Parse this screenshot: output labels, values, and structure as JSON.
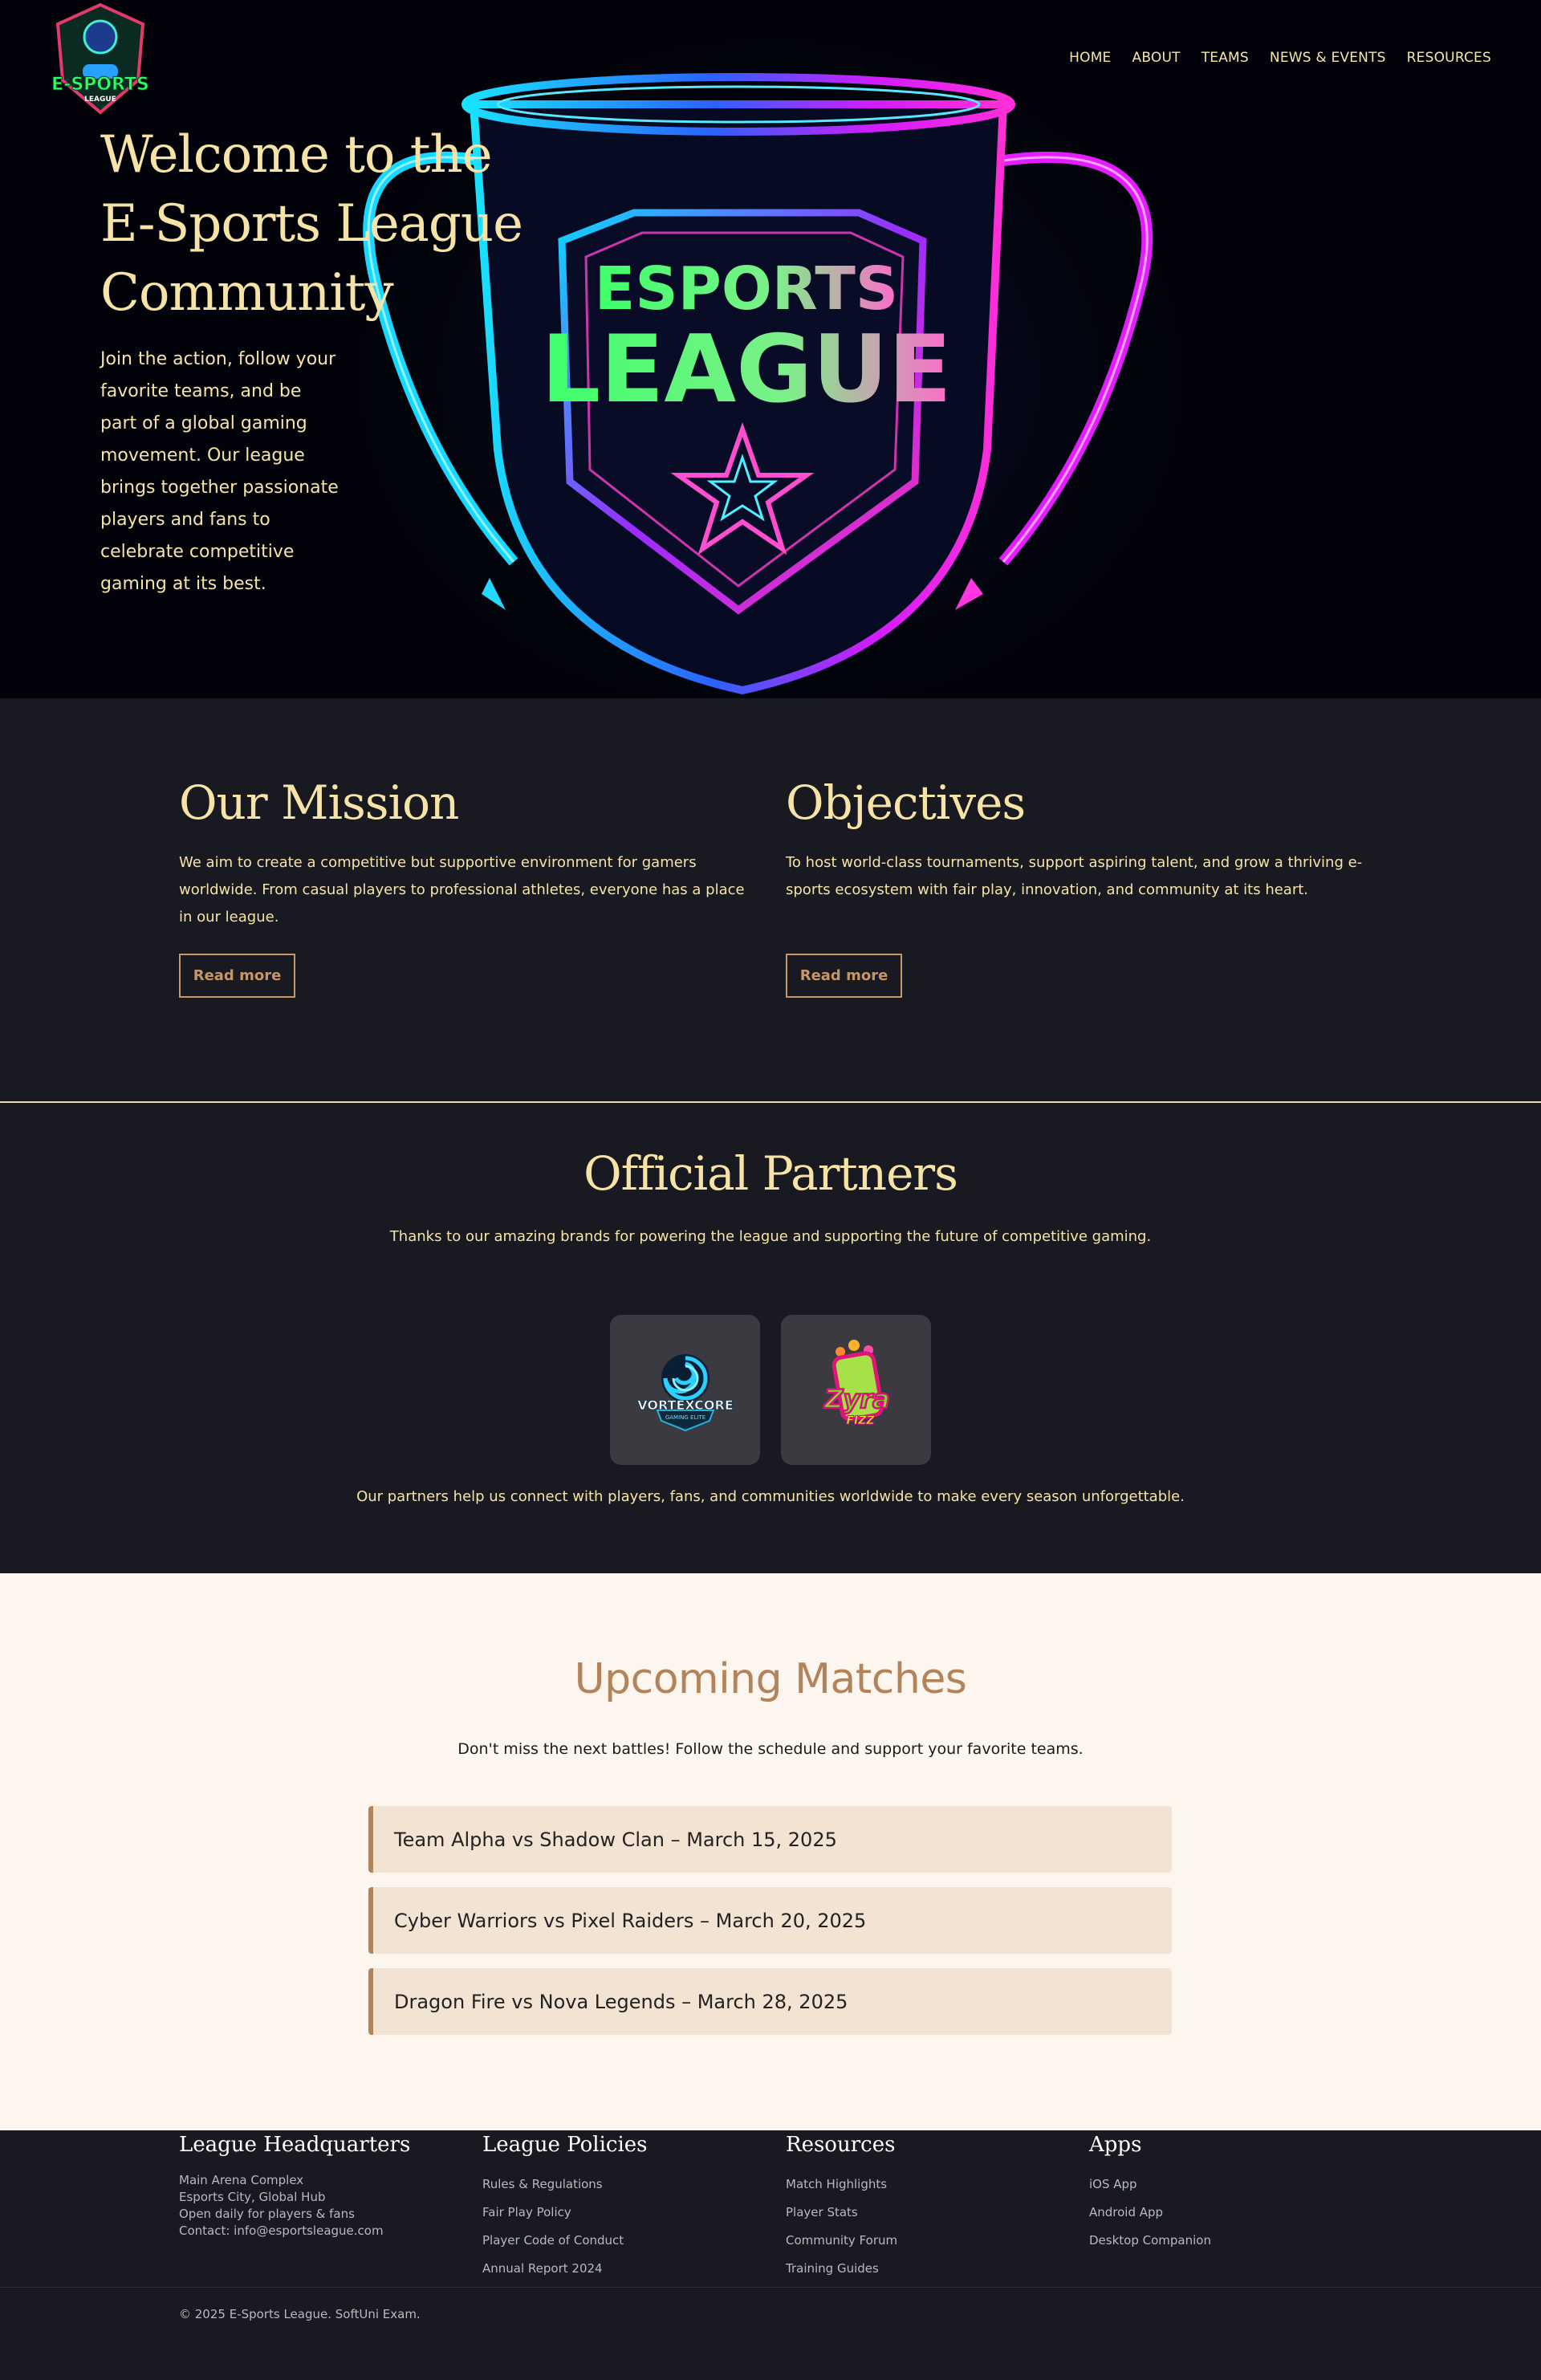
{
  "nav": {
    "items": [
      {
        "label": "HOME"
      },
      {
        "label": "ABOUT"
      },
      {
        "label": "TEAMS"
      },
      {
        "label": "NEWS & EVENTS"
      },
      {
        "label": "RESOURCES"
      }
    ]
  },
  "logo": {
    "text": "E-SPORTS",
    "subtext": "LEAGUE",
    "icon": "gamer-mascot-logo"
  },
  "hero": {
    "title": "Welcome to the E-Sports League Community",
    "text": "Join the action, follow your favorite teams, and be part of a global gaming movement. Our league brings together passionate players and fans to celebrate competitive gaming at its best.",
    "art": {
      "top": "ESPORTS",
      "bottom": "LEAGUE",
      "icon": "neon-trophy"
    }
  },
  "mission": {
    "title": "Our Mission",
    "text": "We aim to create a competitive but supportive environment for gamers worldwide. From casual players to professional athletes, everyone has a place in our league.",
    "button": "Read more"
  },
  "objectives": {
    "title": "Objectives",
    "text": "To host world-class tournaments, support aspiring talent, and grow a thriving e-sports ecosystem with fair play, innovation, and community at its heart.",
    "button": "Read more"
  },
  "partners": {
    "title": "Official Partners",
    "subtitle": "Thanks to our amazing brands for powering the league and supporting the future of competitive gaming.",
    "logos": [
      {
        "name": "VORTEXCORE",
        "tagline": "GAMING ELITE",
        "icon": "vortex-logo"
      },
      {
        "name": "Zyra",
        "tagline": "FIZZ",
        "icon": "soda-can-logo"
      }
    ],
    "note": "Our partners help us connect with players, fans, and communities worldwide to make every season unforgettable."
  },
  "matches": {
    "title": "Upcoming Matches",
    "subtitle": "Don't miss the next battles! Follow the schedule and support your favorite teams.",
    "items": [
      {
        "label": "Team Alpha vs Shadow Clan – March 15, 2025"
      },
      {
        "label": "Cyber Warriors vs Pixel Raiders – March 20, 2025"
      },
      {
        "label": "Dragon Fire vs Nova Legends – March 28, 2025"
      }
    ]
  },
  "footer": {
    "hq": {
      "title": "League Headquarters",
      "lines": [
        "Main Arena Complex",
        "Esports City, Global Hub",
        "Open daily for players & fans",
        "Contact: info@esportsleague.com"
      ]
    },
    "policies": {
      "title": "League Policies",
      "links": [
        "Rules & Regulations",
        "Fair Play Policy",
        "Player Code of Conduct",
        "Annual Report 2024"
      ]
    },
    "resources": {
      "title": "Resources",
      "links": [
        "Match Highlights",
        "Player Stats",
        "Community Forum",
        "Training Guides"
      ]
    },
    "apps": {
      "title": "Apps",
      "links": [
        "iOS App",
        "Android App",
        "Desktop Companion"
      ]
    },
    "copyright": "© 2025 E-Sports League. SoftUni Exam."
  },
  "colors": {
    "accent": "#f7e3a6",
    "button": "#c79663",
    "matches_title": "#b3835a",
    "dark_bg": "#181921",
    "light_bg": "#fdf6ef"
  }
}
